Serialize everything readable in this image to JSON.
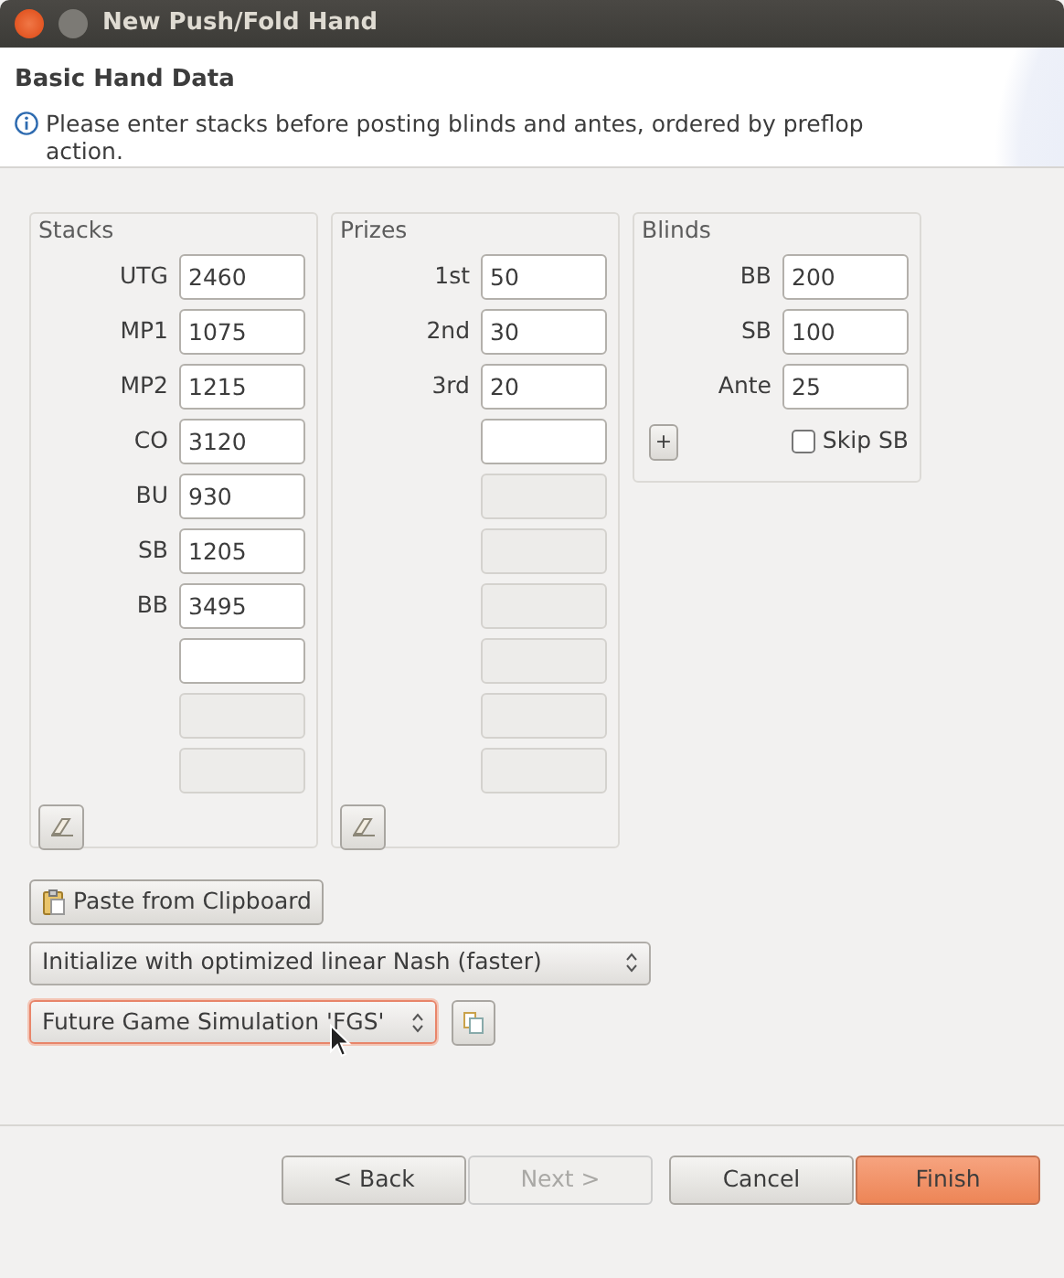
{
  "window": {
    "title": "New Push/Fold Hand"
  },
  "header": {
    "title": "Basic Hand Data",
    "message": "Please enter stacks before posting blinds and antes, ordered by preflop action."
  },
  "groups": [
    {
      "kind": "list",
      "title": "Stacks",
      "fields": [
        {
          "label": "UTG",
          "value": "2460",
          "disabled": false
        },
        {
          "label": "MP1",
          "value": "1075",
          "disabled": false
        },
        {
          "label": "MP2",
          "value": "1215",
          "disabled": false
        },
        {
          "label": "CO",
          "value": "3120",
          "disabled": false
        },
        {
          "label": "BU",
          "value": "930",
          "disabled": false
        },
        {
          "label": "SB",
          "value": "1205",
          "disabled": false
        },
        {
          "label": "BB",
          "value": "3495",
          "disabled": false
        },
        {
          "disabled": false
        },
        {
          "disabled": true
        },
        {
          "disabled": true
        }
      ]
    },
    {
      "kind": "list",
      "title": "Prizes",
      "fields": [
        {
          "label": "1st",
          "value": "50",
          "disabled": false
        },
        {
          "label": "2nd",
          "value": "30",
          "disabled": false
        },
        {
          "label": "3rd",
          "value": "20",
          "disabled": false
        },
        {
          "disabled": false
        },
        {
          "disabled": true
        },
        {
          "disabled": true
        },
        {
          "disabled": true
        },
        {
          "disabled": true
        },
        {
          "disabled": true
        },
        {
          "disabled": true
        }
      ]
    },
    {
      "kind": "blinds",
      "title": "Blinds",
      "fields": [
        {
          "label": "BB",
          "value": "200",
          "disabled": false
        },
        {
          "label": "SB",
          "value": "100",
          "disabled": false
        },
        {
          "label": "Ante",
          "value": "25",
          "disabled": false
        }
      ],
      "add_button": "+",
      "skip_sb": {
        "label": "Skip SB",
        "checked": false
      }
    }
  ],
  "paste_button": "Paste from Clipboard",
  "combos": [
    {
      "value": "Initialize with optimized linear Nash (faster)",
      "focused": false,
      "copy_button": false
    },
    {
      "value": "Future Game Simulation 'FGS'",
      "focused": true,
      "copy_button": true
    }
  ],
  "buttons": [
    {
      "label": "< Back",
      "disabled": false,
      "default": false
    },
    {
      "label": "Next >",
      "disabled": true,
      "default": false
    },
    {
      "label": "Cancel",
      "disabled": false,
      "default": false
    },
    {
      "label": "Finish",
      "disabled": false,
      "default": true
    }
  ]
}
